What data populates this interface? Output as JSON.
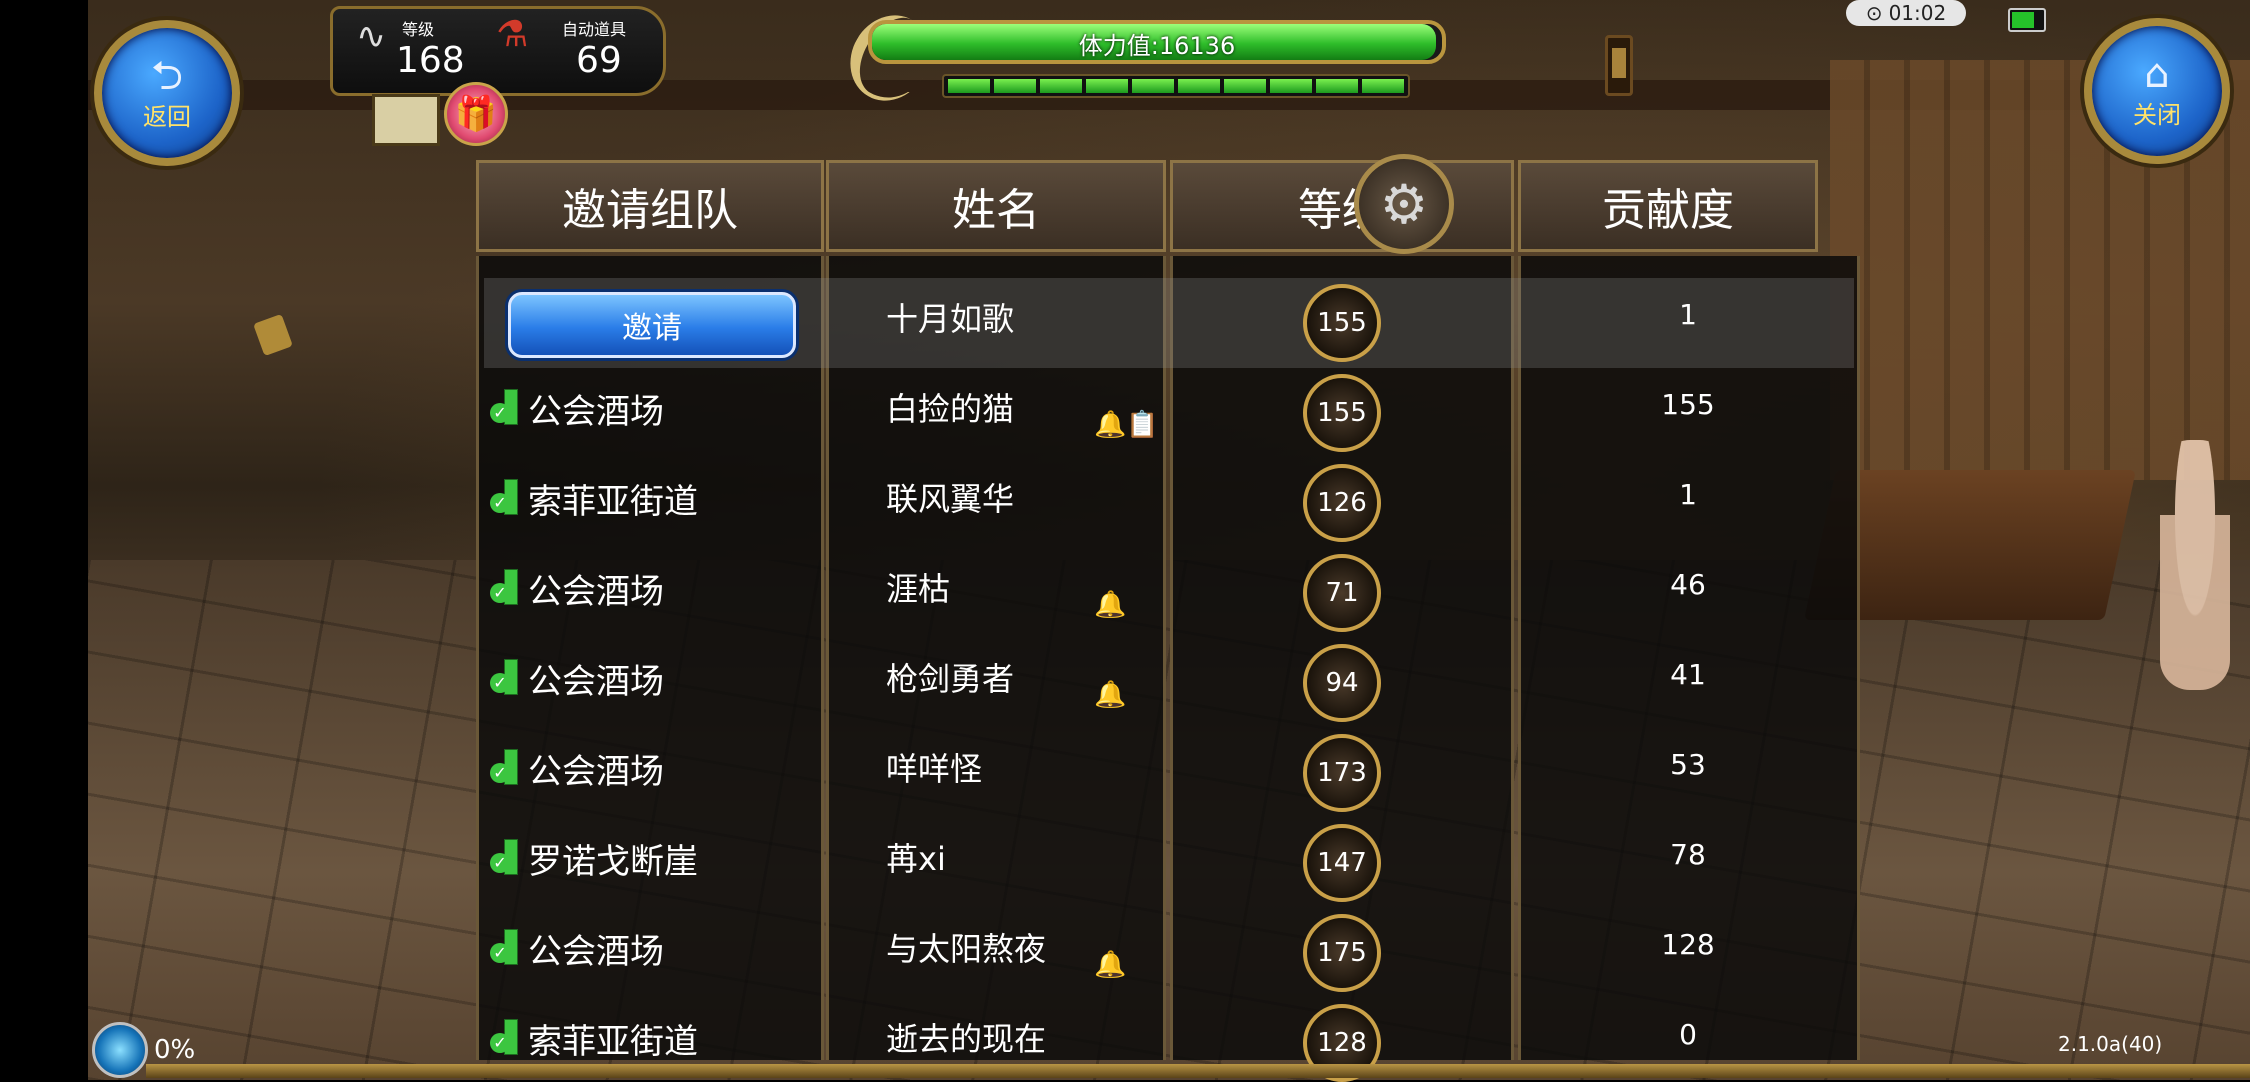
{
  "hud": {
    "back_label": "返回",
    "close_label": "关闭",
    "level_label": "等级",
    "level_value": "168",
    "auto_items_label": "自动道具",
    "auto_items_value": "69",
    "stamina_text": "体力值:16136",
    "stamina_fraction": 0.99,
    "stamina_segments": 10
  },
  "status": {
    "clock": "01:02",
    "progress": "0%",
    "version": "2.1.0a(40)"
  },
  "table": {
    "headers": [
      "邀请组队",
      "姓名",
      "等级",
      "贡献度"
    ],
    "invite_label": "邀请",
    "rows": [
      {
        "location": "",
        "name": "十月如歌",
        "level": "155",
        "contribution": "1",
        "badges": ""
      },
      {
        "location": "公会酒场",
        "name": "白捡的猫",
        "level": "155",
        "contribution": "155",
        "badges": "🔔📋"
      },
      {
        "location": "索菲亚街道",
        "name": "联风翼华",
        "level": "126",
        "contribution": "1",
        "badges": ""
      },
      {
        "location": "公会酒场",
        "name": "涯枯",
        "level": "71",
        "contribution": "46",
        "badges": "🔔"
      },
      {
        "location": "公会酒场",
        "name": "枪剑勇者",
        "level": "94",
        "contribution": "41",
        "badges": "🔔"
      },
      {
        "location": "公会酒场",
        "name": "咩咩怪",
        "level": "173",
        "contribution": "53",
        "badges": ""
      },
      {
        "location": "罗诺戈断崖",
        "name": "苒xi",
        "level": "147",
        "contribution": "78",
        "badges": ""
      },
      {
        "location": "公会酒场",
        "name": "与太阳熬夜",
        "level": "175",
        "contribution": "128",
        "badges": "🔔"
      },
      {
        "location": "索菲亚街道",
        "name": "逝去的现在",
        "level": "128",
        "contribution": "0",
        "badges": ""
      }
    ]
  }
}
